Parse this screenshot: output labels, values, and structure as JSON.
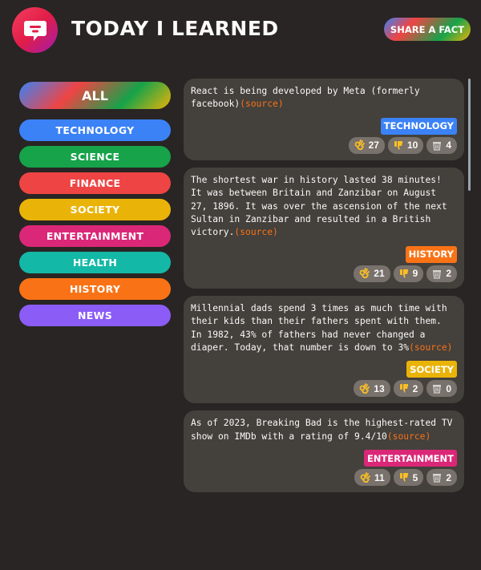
{
  "header": {
    "title": "Today I Learned",
    "share_label": "Share a fact"
  },
  "sidebar": {
    "all_label": "All",
    "categories": [
      {
        "label": "Technology",
        "color": "#3b82f6"
      },
      {
        "label": "Science",
        "color": "#16a34a"
      },
      {
        "label": "Finance",
        "color": "#ef4444"
      },
      {
        "label": "Society",
        "color": "#eab308"
      },
      {
        "label": "Entertainment",
        "color": "#db2777"
      },
      {
        "label": "Health",
        "color": "#14b8a6"
      },
      {
        "label": "History",
        "color": "#f97316"
      },
      {
        "label": "News",
        "color": "#8b5cf6"
      }
    ]
  },
  "facts": [
    {
      "text": "React is being developed by Meta (formerly facebook)",
      "source_label": "(source)",
      "category": "Technology",
      "category_color": "#3b82f6",
      "votes_interesting": "27",
      "votes_mindblowing": "10",
      "votes_false": "4"
    },
    {
      "text": "The shortest war in history lasted 38 minutes! It was between Britain and Zanzibar on August 27, 1896. It was over the ascension of the next Sultan in Zanzibar and resulted in a British victory.",
      "source_label": "(source)",
      "category": "History",
      "category_color": "#f97316",
      "votes_interesting": "21",
      "votes_mindblowing": "9",
      "votes_false": "2"
    },
    {
      "text": "Millennial dads spend 3 times as much time with their kids than their fathers spent with them. In 1982, 43% of fathers had never changed a diaper. Today, that number is down to 3%",
      "source_label": "(source)",
      "category": "Society",
      "category_color": "#eab308",
      "votes_interesting": "13",
      "votes_mindblowing": "2",
      "votes_false": "0"
    },
    {
      "text": "As of 2023, Breaking Bad is the highest-rated TV show on IMDb with a rating of 9.4/10",
      "source_label": "(source)",
      "category": "Entertainment",
      "category_color": "#db2777",
      "votes_interesting": "11",
      "votes_mindblowing": "5",
      "votes_false": "2"
    }
  ],
  "icons": {
    "logo": "speech-bubble-icon",
    "interesting": "ok-hand-icon",
    "mindblowing": "thumbs-down-icon",
    "false": "trash-icon"
  }
}
